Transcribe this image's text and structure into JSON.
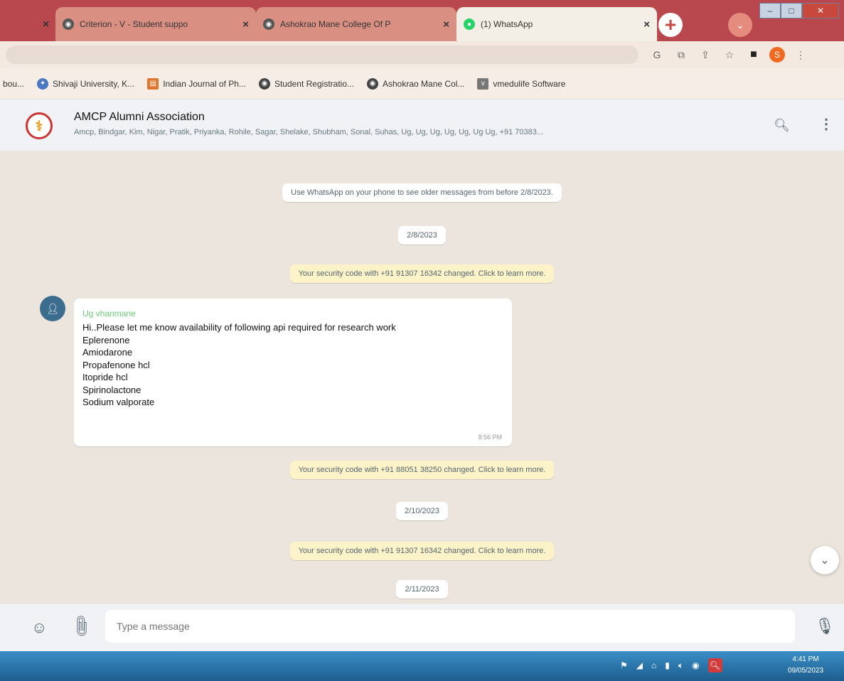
{
  "browser": {
    "tabs": [
      {
        "title": "Criterion - V - Student suppo",
        "close": "×"
      },
      {
        "title": "Ashokrao Mane College Of P",
        "close": "×"
      },
      {
        "title": "(1) WhatsApp",
        "close": "×"
      }
    ],
    "left_close": "×",
    "new_tab": "+",
    "tab_menu": "⌄",
    "bookmarks": [
      {
        "label": "bou..."
      },
      {
        "label": "Shivaji University, K..."
      },
      {
        "label": "Indian Journal of Ph..."
      },
      {
        "label": "Student Registratio..."
      },
      {
        "label": "Ashokrao Mane Col..."
      },
      {
        "label": "vmedulife Software"
      }
    ],
    "profile_initial": "S"
  },
  "chat": {
    "group_name": "AMCP Alumni Association",
    "members": "Amcp, Bindgar, Kim, Nigar, Pratik, Priyanka, Rohile, Sagar, Shelake, Shubham, Sonal, Suhas, Ug, Ug, Ug, Ug, Ug, Ug Ug, +91 70383...",
    "older_notice": "Use WhatsApp on your phone to see older messages from before 2/8/2023.",
    "date1": "2/8/2023",
    "security1": "Your security code with +91 91307 16342 changed. Click to learn more.",
    "message": {
      "sender": "Ug vhanmane",
      "lines": [
        "Hi..Please let me know availability of following api required for research work",
        "Eplerenone",
        "Amiodarone",
        "Propafenone hcl",
        "Itopride hcl",
        "Spirinolactone",
        "Sodium valporate"
      ],
      "time": "8:56 PM"
    },
    "security2": "Your security code with +91 88051 38250 changed. Click to learn more.",
    "date2": "2/10/2023",
    "security3": "Your security code with +91 91307 16342 changed. Click to learn more.",
    "date3": "2/11/2023"
  },
  "composer": {
    "placeholder": "Type a message"
  },
  "taskbar": {
    "time": "4:41 PM",
    "date": "09/05/2023"
  }
}
